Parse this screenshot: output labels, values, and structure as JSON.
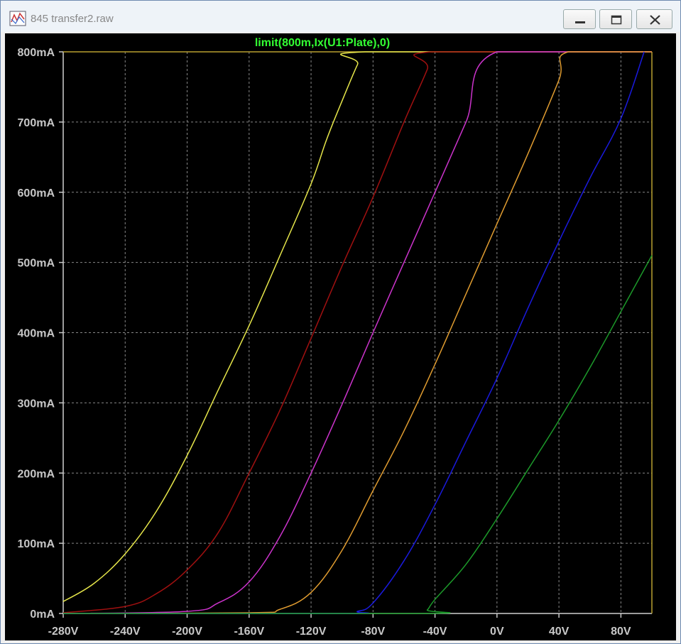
{
  "window": {
    "title": "845 transfer2.raw",
    "icon": "waveform-viewer-icon",
    "controls": [
      "minimize-icon",
      "maximize-icon",
      "close-icon"
    ]
  },
  "colors": {
    "background": "#000000",
    "grid": "#888888",
    "axis_text": "#c8c8c8",
    "title_text": "#33ff33"
  },
  "chart_data": {
    "type": "line",
    "title": "limit(800m,Ix(U1:Plate),0)",
    "xlabel": "",
    "ylabel": "",
    "xlim": [
      -280,
      100
    ],
    "ylim": [
      0,
      800
    ],
    "grid": true,
    "x_ticks": [
      -280,
      -240,
      -200,
      -160,
      -120,
      -80,
      -40,
      0,
      40,
      80
    ],
    "x_tick_labels": [
      "-280V",
      "-240V",
      "-200V",
      "-160V",
      "-120V",
      "-80V",
      "-40V",
      "0V",
      "40V",
      "80V"
    ],
    "y_ticks": [
      0,
      100,
      200,
      300,
      400,
      500,
      600,
      700,
      800
    ],
    "y_tick_labels": [
      "0mA",
      "100mA",
      "200mA",
      "300mA",
      "400mA",
      "500mA",
      "600mA",
      "700mA",
      "800mA"
    ],
    "series": [
      {
        "color": "#e6e64a",
        "x": [
          -280,
          -260,
          -240,
          -220,
          -200,
          -180,
          -160,
          -140,
          -120,
          -110,
          -100,
          -90,
          -85,
          100
        ],
        "values": [
          17,
          43,
          85,
          145,
          225,
          318,
          410,
          510,
          612,
          675,
          730,
          782,
          800,
          800
        ]
      },
      {
        "color": "#a01010",
        "x": [
          -280,
          -240,
          -220,
          -200,
          -180,
          -160,
          -140,
          -120,
          -100,
          -80,
          -60,
          -45,
          -42,
          100
        ],
        "values": [
          1,
          10,
          28,
          62,
          115,
          200,
          290,
          392,
          495,
          593,
          700,
          775,
          800,
          800
        ]
      },
      {
        "color": "#cc33cc",
        "x": [
          -280,
          -200,
          -180,
          -160,
          -140,
          -120,
          -100,
          -80,
          -60,
          -40,
          -20,
          0,
          100
        ],
        "values": [
          0,
          3,
          15,
          45,
          110,
          200,
          298,
          400,
          500,
          600,
          700,
          800,
          800
        ]
      },
      {
        "color": "#e09c30",
        "x": [
          -280,
          -160,
          -140,
          -120,
          -100,
          -80,
          -60,
          -40,
          -20,
          0,
          20,
          40,
          46,
          100
        ],
        "values": [
          0,
          1,
          6,
          30,
          90,
          175,
          260,
          355,
          455,
          555,
          655,
          760,
          800,
          800
        ]
      },
      {
        "color": "#1a1add",
        "x": [
          -280,
          -100,
          -90,
          -80,
          -60,
          -40,
          -20,
          0,
          20,
          40,
          60,
          80,
          95
        ],
        "values": [
          0,
          0,
          3,
          15,
          75,
          155,
          245,
          335,
          435,
          530,
          620,
          705,
          800
        ]
      },
      {
        "color": "#1c9a2a",
        "x": [
          -280,
          -50,
          -45,
          -40,
          -20,
          0,
          20,
          40,
          60,
          80,
          100
        ],
        "values": [
          0,
          0,
          5,
          20,
          70,
          135,
          205,
          275,
          350,
          430,
          510
        ]
      }
    ]
  }
}
